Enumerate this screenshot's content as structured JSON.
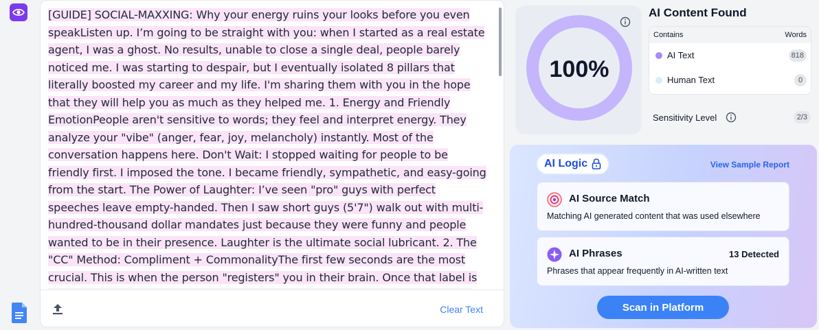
{
  "editor": {
    "text": "[GUIDE] SOCIAL-MAXXING: Why your energy ruins your looks before you even speakListen up. I’m going to be straight with you: when I started as a real estate agent, I was a ghost. No results, unable to close a single deal, people barely noticed me. I was starting to despair, but I eventually isolated 8 pillars that literally boosted my career and my life. I'm sharing them with you in the hope that they will help you as much as they helped me. 1. Energy and Friendly EmotionPeople aren't sensitive to words; they feel and interpret energy. They analyze your \"vibe\" (anger, fear, joy, melancholy) instantly. Most of the conversation happens here. Don't Wait: I stopped waiting for people to be friendly first. I imposed the tone. I became friendly, sympathetic, and easy-going from the start. The Power of Laughter: I’ve seen \"pro\" guys with perfect speeches leave empty-handed. Then I saw short guys (5'7\") walk out with multi-hundred-thousand dollar mandates just because they were funny and people wanted to be in their presence. Laughter is the ultimate social lubricant. 2. The \"CC\" Method: Compliment + CommonalityThe first few seconds are the most crucial. This is when the person \"registers\" you in their brain. Once that label is set, it's almost impossible to change. The Registry: If you meet someone while you're in",
    "clear_label": "Clear Text",
    "highlight_color": "#fbe4f7"
  },
  "result": {
    "score": "100%",
    "score_value": 1.0,
    "ring_color": "#c4b5fd",
    "title": "AI Content Found",
    "table": {
      "col_left": "Contains",
      "col_right": "Words",
      "rows": [
        {
          "label": "AI Text",
          "count": "818",
          "dot_color": "#a78bfa"
        },
        {
          "label": "Human Text",
          "count": "0",
          "dot_color": "#dbeafe"
        }
      ]
    },
    "sensitivity_label": "Sensitivity Level",
    "sensitivity_value": "2/3"
  },
  "logic": {
    "pill_label": "AI Logic",
    "view_report": "View Sample Report",
    "cards": [
      {
        "title": "AI Source Match",
        "desc": "Matching AI generated content that was used elsewhere",
        "count": ""
      },
      {
        "title": "AI Phrases",
        "desc": "Phrases that appear frequently in AI-written text",
        "count": "13 Detected"
      }
    ],
    "scan_label": "Scan in Platform"
  }
}
